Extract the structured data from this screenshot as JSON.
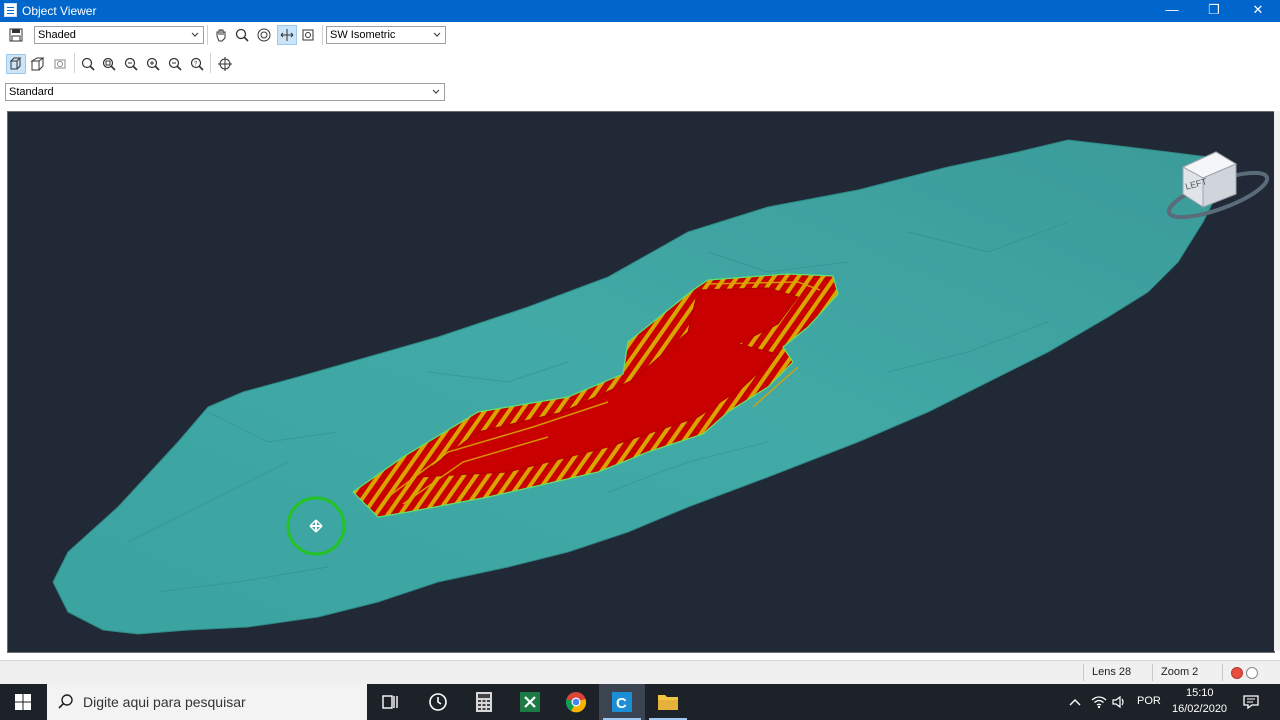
{
  "window": {
    "title": "Object Viewer",
    "controls": [
      "—",
      "❐",
      "✕"
    ]
  },
  "toolbar": {
    "visual_style": "Shaded",
    "view": "SW Isometric",
    "named_view": "Standard"
  },
  "viewport": {
    "background": "#212836",
    "surface_color": "#3a9e9e",
    "pit_color": "#c80000",
    "bench_color": "#d4a000",
    "viewcube_face": "LEFT"
  },
  "status": {
    "lens": "Lens 28",
    "zoom": "Zoom 2"
  },
  "taskbar": {
    "search_placeholder": "Digite aqui para pesquisar",
    "language": "POR",
    "time": "15:10",
    "date": "16/02/2020"
  }
}
